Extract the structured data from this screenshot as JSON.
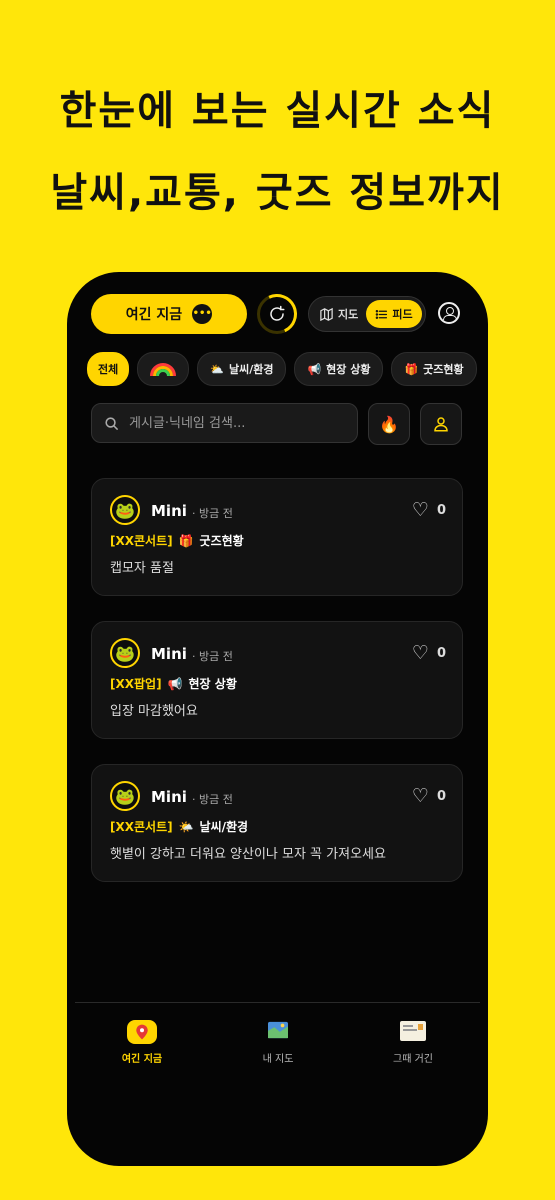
{
  "promo": {
    "line1": "한눈에 보는 실시간 소식",
    "line2": "날씨,교통, 굿즈 정보까지"
  },
  "header": {
    "now_label": "여긴 지금",
    "toggle_map": "지도",
    "toggle_feed": "피드"
  },
  "filters": [
    {
      "label": "전체",
      "active": true
    },
    {
      "label": "",
      "icon": "rainbow-icon"
    },
    {
      "label": "날씨/환경",
      "icon": "sun-cloud-icon"
    },
    {
      "label": "현장 상황",
      "icon": "megaphone-icon"
    },
    {
      "label": "굿즈현황",
      "icon": "gift-icon"
    }
  ],
  "search": {
    "placeholder": "게시글·닉네임 검색..."
  },
  "posts": [
    {
      "user": "Mini",
      "time": "· 방금 전",
      "likes": "0",
      "tag": "[XX콘서트]",
      "category_emoji": "🎁",
      "category": "굿즈현황",
      "text": "캡모자 품절"
    },
    {
      "user": "Mini",
      "time": "· 방금 전",
      "likes": "0",
      "tag": "[XX팝업]",
      "category_emoji": "📢",
      "category": "현장 상황",
      "text": "입장 마감했어요"
    },
    {
      "user": "Mini",
      "time": "· 방금 전",
      "likes": "0",
      "tag": "[XX콘서트]",
      "category_emoji": "🌤️",
      "category": "날씨/환경",
      "text": "햇볕이 강하고 더워요 양산이나 모자 꼭 가져오세요"
    }
  ],
  "nav": [
    {
      "label": "여긴 지금",
      "icon": "map-pin-icon",
      "active": true
    },
    {
      "label": "내 지도",
      "icon": "map-icon",
      "active": false
    },
    {
      "label": "그때 거긴",
      "icon": "card-icon",
      "active": false
    }
  ],
  "colors": {
    "background": "#FFE60A",
    "accent": "#FFD500",
    "phone": "#050505"
  }
}
